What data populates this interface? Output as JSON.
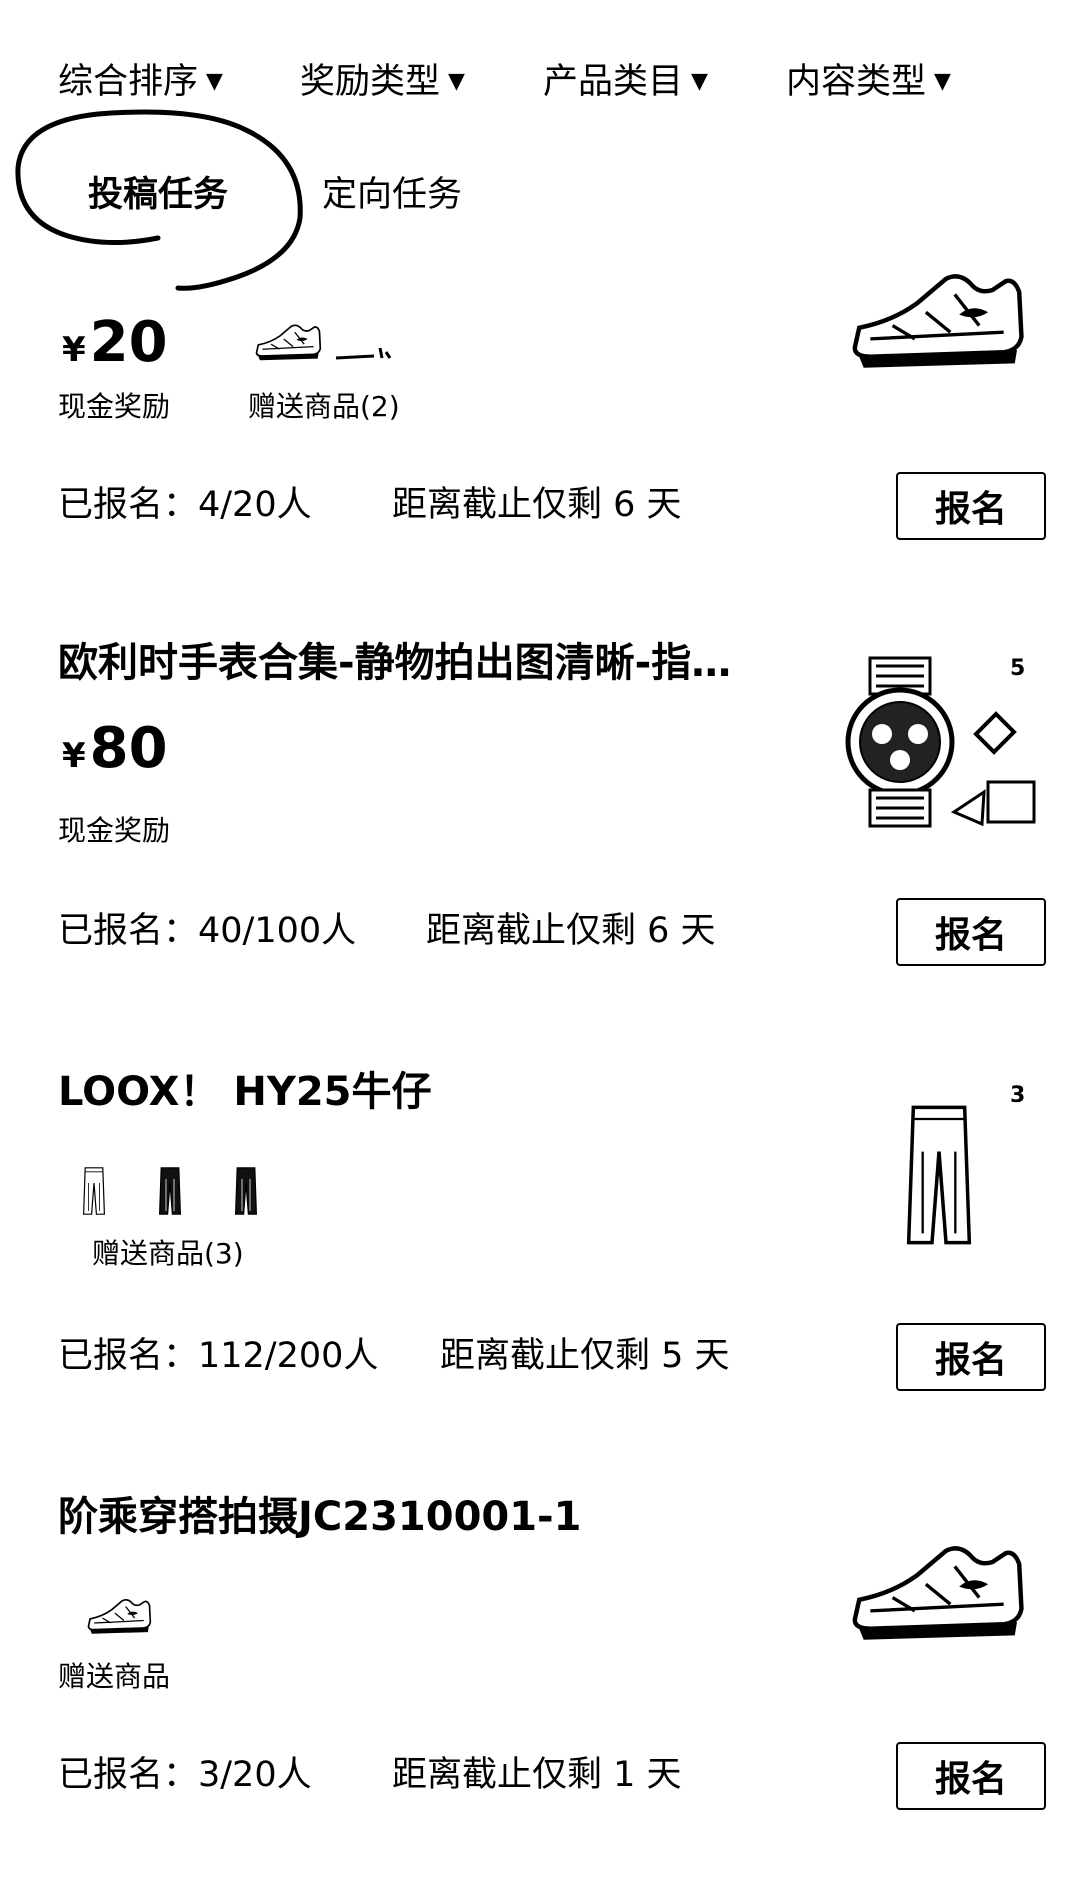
{
  "filters": {
    "sort": "综合排序",
    "reward_type": "奖励类型",
    "product_category": "产品类目",
    "content_type": "内容类型"
  },
  "tabs": {
    "submission": "投稿任务",
    "directed": "定向任务"
  },
  "cards": [
    {
      "title": "",
      "currency": "¥",
      "price": "20",
      "cash_label": "现金奖励",
      "gift_label": "赠送商品(2)",
      "enrolled": "已报名：4/20人",
      "deadline": "距离截止仅剩 6 天",
      "button": "报名",
      "thumb_icon": "sneaker-icon"
    },
    {
      "title": "欧利时手表合集-静物拍出图清晰-指…",
      "currency": "¥",
      "price": "80",
      "cash_label": "现金奖励",
      "image_count": "5",
      "enrolled": "已报名：40/100人",
      "deadline": "距离截止仅剩 6 天",
      "button": "报名",
      "thumb_icon": "watch-icon"
    },
    {
      "title": "LOOX！ HY25牛仔",
      "gift_label": "赠送商品(3)",
      "image_count": "3",
      "enrolled": "已报名：112/200人",
      "deadline": "距离截止仅剩 5 天",
      "button": "报名",
      "thumb_icon": "jeans-icon"
    },
    {
      "title": "阶乘穿搭拍摄JC2310001-1",
      "gift_label": "赠送商品",
      "enrolled": "已报名：3/20人",
      "deadline": "距离截止仅剩 1 天",
      "button": "报名",
      "thumb_icon": "sneaker-icon"
    }
  ]
}
